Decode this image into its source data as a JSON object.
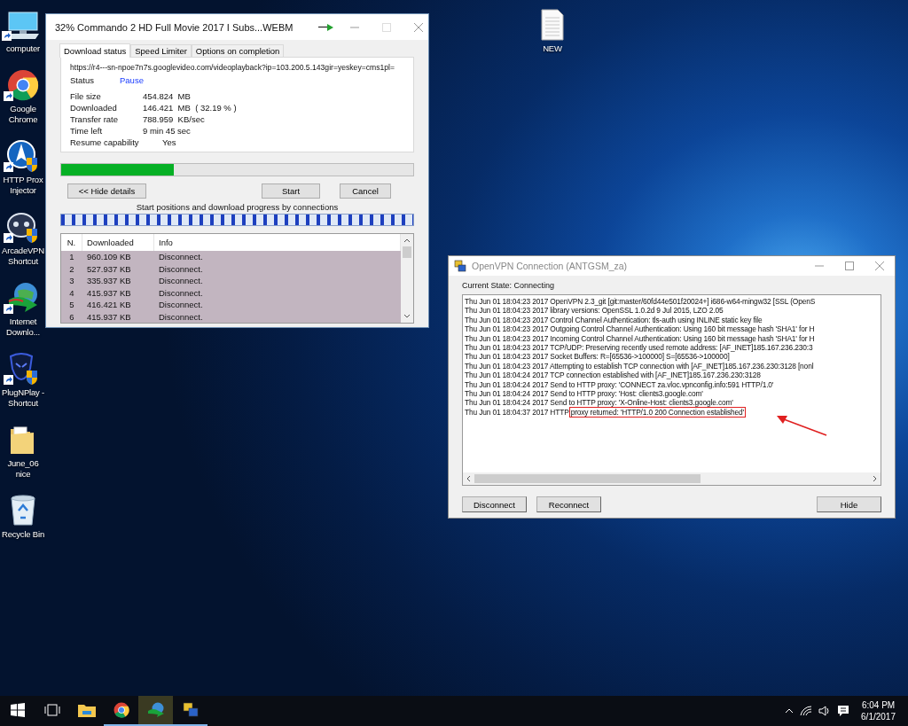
{
  "desktop_icons": [
    {
      "kind": "computer",
      "label": "computer",
      "shortcut": true
    },
    {
      "kind": "chrome",
      "label": "Google Chrome",
      "shortcut": true
    },
    {
      "kind": "proxy",
      "label": "HTTP Prox Injector",
      "shortcut": true
    },
    {
      "kind": "gamepad",
      "label": "ArcadeVPN Shortcut",
      "shortcut": true
    },
    {
      "kind": "globe",
      "label": "Internet Downlo...",
      "shortcut": true
    },
    {
      "kind": "mask",
      "label": "PlugNPlay - Shortcut",
      "shortcut": true
    },
    {
      "kind": "folder",
      "label": "June_06 nice",
      "shortcut": false
    },
    {
      "kind": "recycle",
      "label": "Recycle Bin",
      "shortcut": false
    }
  ],
  "desktop_file": {
    "kind": "document",
    "label": "NEW",
    "shortcut": false
  },
  "download_window": {
    "title": "32% Commando 2 HD Full Movie 2017 I Subs...WEBM",
    "tabs": [
      {
        "label": "Download status",
        "selected": true
      },
      {
        "label": "Speed Limiter",
        "selected": false
      },
      {
        "label": "Options on completion",
        "selected": false
      }
    ],
    "url": "https://r4---sn-npoe7n7s.googlevideo.com/videoplayback?ip=103.200.5.143gir=yeskey=cms1pl=",
    "status": {
      "label": "Status",
      "value": "Pause"
    },
    "fields": [
      {
        "label": "File size",
        "value": "454.824  MB"
      },
      {
        "label": "Downloaded",
        "value": "146.421  MB  ( 32.19 % )"
      },
      {
        "label": "Transfer rate",
        "value": "788.959  KB/sec"
      },
      {
        "label": "Time left",
        "value": "9 min 45 sec"
      },
      {
        "label": "Resume capability",
        "value": "Yes"
      }
    ],
    "progress": {
      "level": 0.32
    },
    "buttons": {
      "details": "<< Hide details",
      "start": "Start",
      "cancel": "Cancel"
    },
    "connections_caption": "Start positions and download progress by connections",
    "table": {
      "columns": [
        "N.",
        "Downloaded",
        "Info"
      ],
      "rows": [
        [
          "1",
          "960.109  KB",
          "Disconnect."
        ],
        [
          "2",
          "527.937  KB",
          "Disconnect."
        ],
        [
          "3",
          "335.937  KB",
          "Disconnect."
        ],
        [
          "4",
          "415.937  KB",
          "Disconnect."
        ],
        [
          "5",
          "416.421  KB",
          "Disconnect."
        ],
        [
          "6",
          "415.937  KB",
          "Disconnect."
        ]
      ]
    }
  },
  "vpn_window": {
    "title": "OpenVPN Connection (ANTGSM_za)",
    "state": "Current State: Connecting",
    "log": [
      {
        "text": "Thu Jun 01 18:04:23 2017 OpenVPN 2.3_git [git:master/60fd44e501f20024+] i686-w64-mingw32 [SSL (OpenS"
      },
      {
        "text": "Thu Jun 01 18:04:23 2017 library versions: OpenSSL 1.0.2d 9 Jul 2015, LZO 2.05"
      },
      {
        "text": "Thu Jun 01 18:04:23 2017 Control Channel Authentication: tls-auth using INLINE static key file"
      },
      {
        "text": "Thu Jun 01 18:04:23 2017 Outgoing Control Channel Authentication: Using 160 bit message hash 'SHA1' for H"
      },
      {
        "text": "Thu Jun 01 18:04:23 2017 Incoming Control Channel Authentication: Using 160 bit message hash 'SHA1' for H"
      },
      {
        "text": "Thu Jun 01 18:04:23 2017 TCP/UDP: Preserving recently used remote address: [AF_INET]185.167.236.230:3"
      },
      {
        "text": "Thu Jun 01 18:04:23 2017 Socket Buffers: R=[65536->100000] S=[65536->100000]"
      },
      {
        "text": "Thu Jun 01 18:04:23 2017 Attempting to establish TCP connection with [AF_INET]185.167.236.230:3128 [nonl"
      },
      {
        "text": "Thu Jun 01 18:04:24 2017 TCP connection established with [AF_INET]185.167.236.230:3128"
      },
      {
        "text": "Thu Jun 01 18:04:24 2017 Send to HTTP proxy: 'CONNECT za.vloc.vpnconfig.info:591 HTTP/1.0'"
      },
      {
        "text": "Thu Jun 01 18:04:24 2017 Send to HTTP proxy: 'Host: clients3.google.com'"
      },
      {
        "text": "Thu Jun 01 18:04:24 2017 Send to HTTP proxy: 'X-Online-Host: clients3.google.com'"
      },
      {
        "text": "Thu Jun 01 18:04:37 2017 HTTP",
        "highlight": "proxy returned: 'HTTP/1.0 200 Connection established'"
      }
    ],
    "buttons": [
      "Disconnect",
      "Reconnect",
      "Hide"
    ]
  },
  "taskbar": {
    "items": [
      {
        "kind": "start",
        "running": false,
        "selected": false
      },
      {
        "kind": "task-view",
        "running": false,
        "selected": false
      },
      {
        "kind": "explorer",
        "running": false,
        "selected": false
      },
      {
        "kind": "chrome",
        "running": true,
        "selected": false
      },
      {
        "kind": "downloader",
        "running": true,
        "selected": true
      },
      {
        "kind": "vpn",
        "running": true,
        "selected": false
      }
    ],
    "clock": {
      "time": "6:04 PM",
      "date": "6/1/2017"
    }
  }
}
